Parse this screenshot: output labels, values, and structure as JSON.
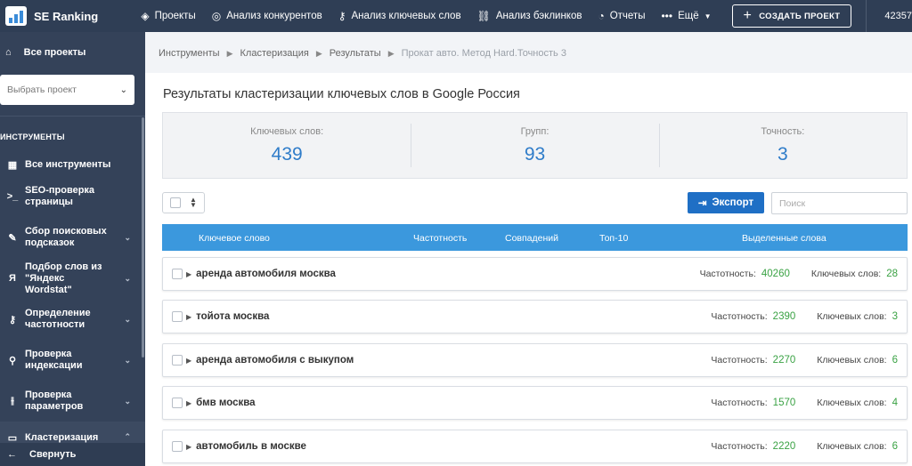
{
  "brand": {
    "name": "SE Ranking",
    "accent": "#3b98dd",
    "button": "#1f6fc5",
    "value_color": "#2f7cc9",
    "green": "#3aa244"
  },
  "topnav": {
    "items": [
      {
        "label": "Проекты",
        "icon": "layers-icon"
      },
      {
        "label": "Анализ конкурентов",
        "icon": "target-icon"
      },
      {
        "label": "Анализ ключевых слов",
        "icon": "key-icon"
      },
      {
        "label": "Анализ бэклинков",
        "icon": "link-icon"
      },
      {
        "label": "Отчеты",
        "icon": "pie-chart-icon"
      },
      {
        "label": "Ещё",
        "icon": "more-dots-icon"
      }
    ],
    "create_label": "СОЗДАТЬ ПРОЕКТ",
    "account": "42357"
  },
  "sidebar": {
    "all_projects": "Все проекты",
    "select_placeholder": "Выбрать проект",
    "section": "ИНСТРУМЕНТЫ",
    "items": [
      {
        "label": "Все инструменты",
        "icon": "grid-icon",
        "chevron": false
      },
      {
        "label": "SEO-проверка страницы",
        "icon": "terminal-icon",
        "chevron": false
      },
      {
        "label": "Сбор поисковых подсказок",
        "icon": "pencil-icon",
        "chevron": true
      },
      {
        "label": "Подбор слов из \"Яндекс Wordstat\"",
        "icon": "yandex-icon",
        "chevron": true
      },
      {
        "label": "Определение частотности",
        "icon": "key-icon",
        "chevron": true
      },
      {
        "label": "Проверка индексации",
        "icon": "search-icon",
        "chevron": true
      },
      {
        "label": "Проверка параметров",
        "icon": "sliders-icon",
        "chevron": true
      },
      {
        "label": "Кластеризация",
        "icon": "folder-icon",
        "chevron": true
      }
    ],
    "collapse": "Свернуть"
  },
  "breadcrumbs": [
    "Инструменты",
    "Кластеризация",
    "Результаты",
    "Прокат авто. Метод Hard.Точность 3"
  ],
  "main": {
    "title": "Результаты кластеризации ключевых слов в Google Россия",
    "stats": [
      {
        "label": "Ключевых слов:",
        "value": "439"
      },
      {
        "label": "Групп:",
        "value": "93"
      },
      {
        "label": "Точность:",
        "value": "3"
      }
    ],
    "export_label": "Экспорт",
    "search_placeholder": "Поиск",
    "columns": [
      "Ключевое слово",
      "Частотность",
      "Совпадений",
      "Топ-10",
      "Выделенные слова"
    ],
    "freq_label": "Частотность:",
    "count_label": "Ключевых слов:",
    "rows": [
      {
        "keyword": "аренда автомобиля москва",
        "freq": "40260",
        "count": "28"
      },
      {
        "keyword": "тойота москва",
        "freq": "2390",
        "count": "3"
      },
      {
        "keyword": "аренда автомобиля с выкупом",
        "freq": "2270",
        "count": "6"
      },
      {
        "keyword": "бмв москва",
        "freq": "1570",
        "count": "4"
      },
      {
        "keyword": "автомобиль в москве",
        "freq": "2220",
        "count": "6"
      }
    ]
  }
}
